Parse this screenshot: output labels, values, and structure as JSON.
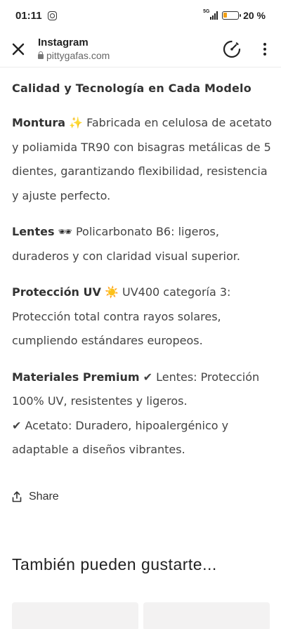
{
  "status_bar": {
    "time": "01:11",
    "network": "5G",
    "battery_percent": "20 %",
    "battery_level": 0.2,
    "battery_color": "#f2a016"
  },
  "browser": {
    "title": "Instagram",
    "url": "pittygafas.com",
    "icons": [
      "close-icon",
      "lock-icon",
      "speed-icon",
      "more-vertical-icon"
    ]
  },
  "content": {
    "heading": "Calidad y Tecnología en Cada Modelo",
    "items": [
      {
        "label": "Montura",
        "emoji": "✨",
        "text": " Fabricada en celulosa de acetato y poliamida TR90 con bisagras metálicas de 5 dientes, garantizando flexibilidad, resistencia y ajuste perfecto."
      },
      {
        "label": "Lentes",
        "emoji": "🕶",
        "text": " Policarbonato B6: ligeros, duraderos y con claridad visual superior."
      },
      {
        "label": "Protección UV",
        "emoji": "☀️",
        "text": " UV400 categoría 3: Protección total contra rayos solares, cumpliendo estándares europeos."
      },
      {
        "label": "Materiales Premium",
        "emoji": "✔",
        "text": " Lentes: Protección 100% UV, resistentes y ligeros.",
        "text2_emoji": "✔",
        "text2": " Acetato: Duradero, hipoalergénico y adaptable a diseños vibrantes."
      }
    ]
  },
  "share": {
    "label": "Share"
  },
  "recommendations": {
    "title": "También pueden gustarte..."
  }
}
